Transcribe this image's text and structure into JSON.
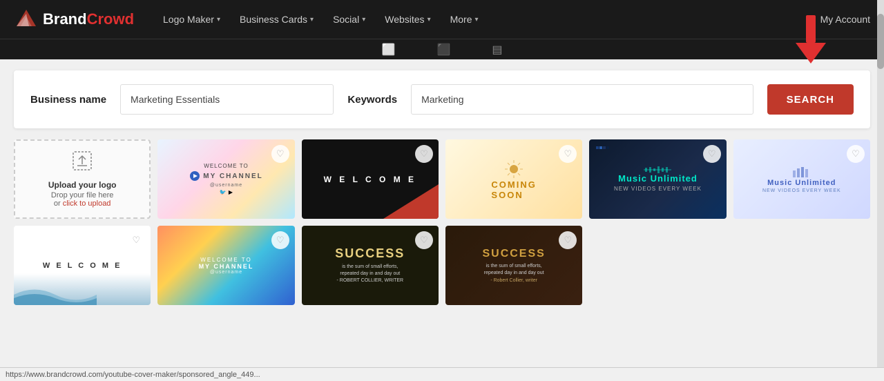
{
  "brand": {
    "name_white": "Brand",
    "name_red": "Crowd",
    "logo_alt": "BrandCrowd Logo"
  },
  "nav": {
    "items": [
      {
        "label": "Logo Maker",
        "has_dropdown": true
      },
      {
        "label": "Business Cards",
        "has_dropdown": true
      },
      {
        "label": "Social",
        "has_dropdown": true
      },
      {
        "label": "Websites",
        "has_dropdown": true
      },
      {
        "label": "More",
        "has_dropdown": true
      }
    ],
    "my_account": "My Account"
  },
  "search": {
    "business_name_label": "Business name",
    "business_name_value": "Marketing Essentials",
    "keywords_label": "Keywords",
    "keywords_value": "Marketing",
    "button_label": "SEARCH"
  },
  "upload_card": {
    "title": "Upload your logo",
    "drop_text": "Drop your file here",
    "or_text": "or",
    "link_text": "click to upload"
  },
  "cards": [
    {
      "id": "welcome-colorful",
      "type": "welcome_channel",
      "has_heart": true
    },
    {
      "id": "welcome-black",
      "type": "welcome_black",
      "has_heart": true
    },
    {
      "id": "coming-soon",
      "type": "coming_soon",
      "has_heart": true
    },
    {
      "id": "music-dark",
      "type": "music_dark",
      "has_heart": true
    },
    {
      "id": "music-light",
      "type": "music_light",
      "has_heart": true
    },
    {
      "id": "welcome-wave",
      "type": "welcome_wave",
      "has_heart": true
    },
    {
      "id": "welcome-color2",
      "type": "welcome_color2",
      "has_heart": true
    },
    {
      "id": "success-dark",
      "type": "success_dark",
      "has_heart": true
    },
    {
      "id": "success-pattern",
      "type": "success_pattern",
      "has_heart": true
    }
  ],
  "status_bar": {
    "url": "https://www.brandcrowd.com/youtube-cover-maker/sponsored_angle_449..."
  }
}
